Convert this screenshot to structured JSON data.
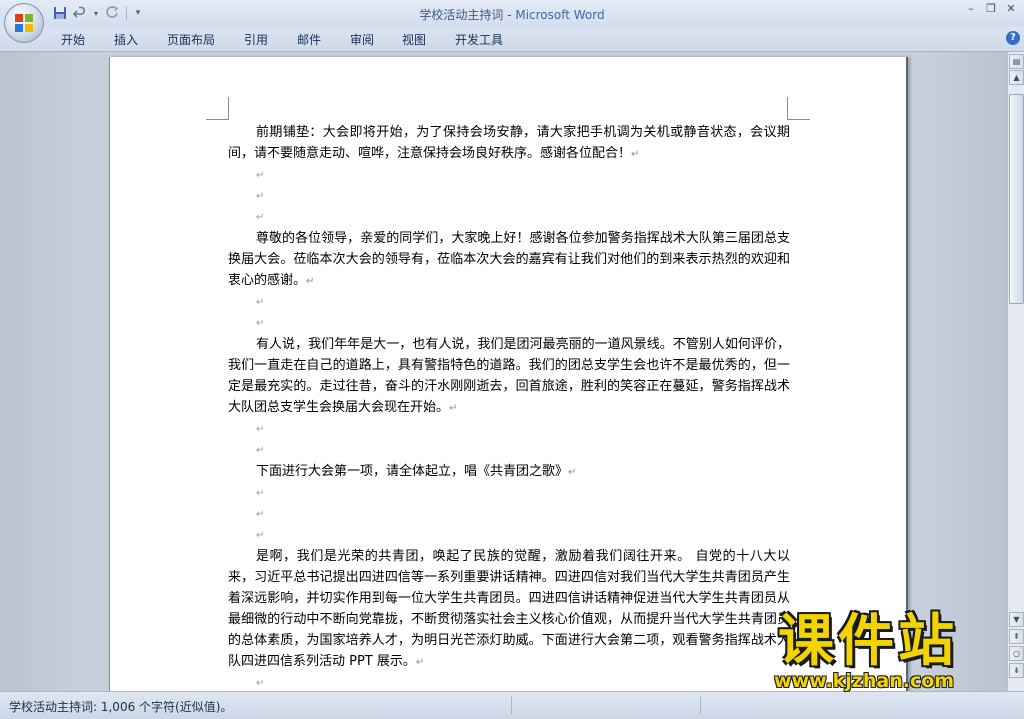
{
  "window": {
    "doc_title": "学校活动主持词",
    "separator": " - ",
    "app_name": "Microsoft Word",
    "minimize_label": "–",
    "restore_label": "❐",
    "close_label": "✕"
  },
  "qat": {
    "save_icon": "save-icon",
    "undo_icon": "undo-icon",
    "redo_icon": "redo-icon",
    "customize_icon": "customize-qat-icon"
  },
  "ribbon": {
    "tabs": [
      "开始",
      "插入",
      "页面布局",
      "引用",
      "邮件",
      "审阅",
      "视图",
      "开发工具"
    ],
    "help_label": "?"
  },
  "document": {
    "paragraph_mark": "↵",
    "paragraphs": [
      "前期铺垫：大会即将开始，为了保持会场安静，请大家把手机调为关机或静音状态，会议期间，请不要随意走动、喧哗，注意保持会场良好秩序。感谢各位配合！",
      "尊敬的各位领导，亲爱的同学们，大家晚上好！感谢各位参加警务指挥战术大队第三届团总支换届大会。莅临本次大会的领导有，莅临本次大会的嘉宾有让我们对他们的到来表示热烈的欢迎和衷心的感谢。",
      "有人说，我们年年是大一，也有人说，我们是团河最亮丽的一道风景线。不管别人如何评价，我们一直走在自己的道路上，具有警指特色的道路。我们的团总支学生会也许不是最优秀的，但一定是最充实的。走过往昔，奋斗的汗水刚刚逝去，回首旅途，胜利的笑容正在蔓延，警务指挥战术大队团总支学生会换届大会现在开始。",
      "下面进行大会第一项，请全体起立，唱《共青团之歌》",
      "是啊，我们是光荣的共青团，唤起了民族的觉醒，激励着我们阔往开来。    自党的十八大以来，习近平总书记提出四进四信等一系列重要讲话精神。四进四信对我们当代大学生共青团员产生着深远影响，并切实作用到每一位大学生共青团员。四进四信讲话精神促进当代大学生共青团员从最细微的行动中不断向党靠拢，不断贯彻落实社会主义核心价值观，从而提升当代大学生共青团员的总体素质，为国家培养人才，为明日光芒添灯助威。下面进行大会第二项，观看警务指挥战术大队四进四信系列活动 PPT 展示。"
    ]
  },
  "statusbar": {
    "text": "学校活动主持词: 1,006 个字符(近似值)。"
  },
  "watermark": {
    "big": "课件站",
    "small": "www.kjzhan.com"
  }
}
